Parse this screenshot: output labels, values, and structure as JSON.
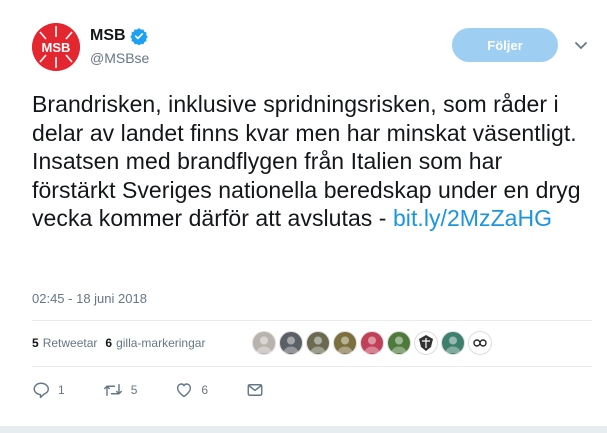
{
  "account": {
    "display_name": "MSB",
    "handle": "@MSBse",
    "logo_text": "MSB",
    "brand_color": "#e3262f"
  },
  "follow_button": {
    "label": "Följer"
  },
  "tweet": {
    "text": "Brandrisken, inklusive spridningsrisken, som råder i delar av landet finns kvar men har minskat väsentligt. Insatsen med brandflygen från Italien som har förstärkt Sveriges nationella beredskap under en dryg vecka kommer därför att avslutas - ",
    "link": "bit.ly/2MzZaHG",
    "timestamp": "02:45 - 18 juni 2018"
  },
  "stats": {
    "retweets_count": "5",
    "retweets_label": "Retweetar",
    "likes_count": "6",
    "likes_label": "gilla-markeringar"
  },
  "likers": [
    {
      "icon": "liker-avatar",
      "color": "#b9b3ad"
    },
    {
      "icon": "liker-avatar",
      "color": "#5b5f66"
    },
    {
      "icon": "liker-avatar",
      "color": "#6b6a50"
    },
    {
      "icon": "liker-avatar",
      "color": "#7b6f3e"
    },
    {
      "icon": "liker-avatar",
      "color": "#c0405a"
    },
    {
      "icon": "liker-avatar",
      "color": "#4e7a3c"
    },
    {
      "icon": "crest-icon",
      "color": "#ffffff"
    },
    {
      "icon": "liker-avatar",
      "color": "#3f7f6e"
    },
    {
      "icon": "infinity-icon",
      "color": "#ffffff"
    }
  ],
  "actions": {
    "reply_count": "1",
    "retweet_count": "5",
    "like_count": "6"
  },
  "colors": {
    "link": "#1b95e0",
    "secondary_text": "#657786",
    "follow_bg": "#9ecff3"
  }
}
